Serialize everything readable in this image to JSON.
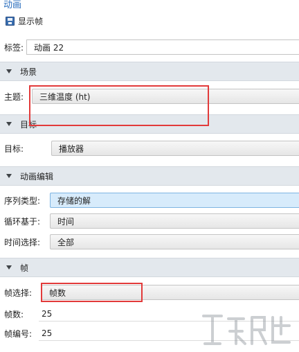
{
  "header": {
    "title": "动画",
    "show_frame_label": "显示帧"
  },
  "label_row": {
    "label": "标签:",
    "value": "动画 22"
  },
  "scene": {
    "section_title": "场景",
    "subject_label": "主题:",
    "subject_value": "三维温度 (ht)"
  },
  "target": {
    "section_title": "目标",
    "target_label": "目标:",
    "target_value": "播放器"
  },
  "animation_edit": {
    "section_title": "动画编辑",
    "sequence_type_label": "序列类型:",
    "sequence_type_value": "存储的解",
    "loop_base_label": "循环基于:",
    "loop_base_value": "时间",
    "time_select_label": "时间选择:",
    "time_select_value": "全部"
  },
  "frames": {
    "section_title": "帧",
    "frame_select_label": "帧选择:",
    "frame_select_value": "帧数",
    "frame_count_label": "帧数:",
    "frame_count_value": "25",
    "frame_number_label": "帧编号:",
    "frame_number_value": "25"
  },
  "colors": {
    "accent": "#2a6ebd",
    "section_bg": "#e3e8ed",
    "highlight": "#e23a3a",
    "selected_bg": "#d7ebfb"
  }
}
